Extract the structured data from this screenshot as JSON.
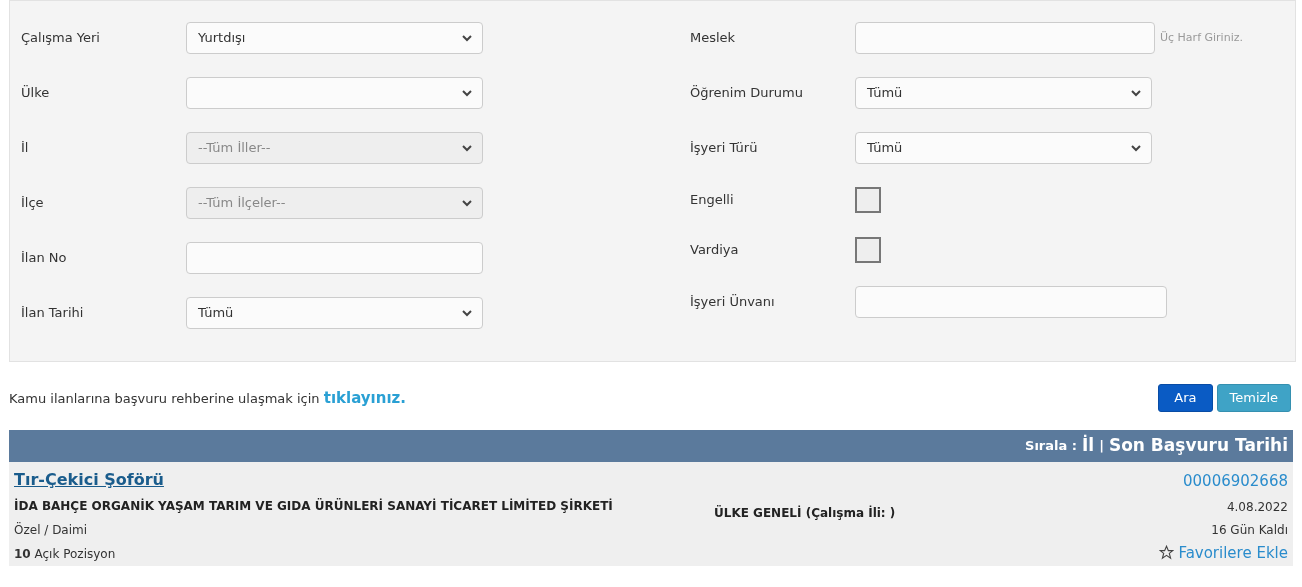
{
  "left_fields": [
    {
      "label": "Çalışma Yeri",
      "kind": "select",
      "value": "Yurtdışı",
      "disabled": false
    },
    {
      "label": "Ülke",
      "kind": "select",
      "disabled": false
    },
    {
      "label": "İl",
      "kind": "select",
      "value": "--Tüm İller--",
      "disabled": true
    },
    {
      "label": "İlçe",
      "kind": "select",
      "value": "--Tüm İlçeler--",
      "disabled": true
    },
    {
      "label": "İlan No",
      "kind": "input",
      "disabled": false
    },
    {
      "label": "İlan Tarihi",
      "kind": "select",
      "value": "Tümü",
      "disabled": false
    }
  ],
  "right_fields": [
    {
      "label": "Meslek",
      "kind": "input",
      "hint": "Üç Harf Giriniz."
    },
    {
      "label": "Öğrenim Durumu",
      "kind": "select",
      "value": "Tümü"
    },
    {
      "label": "İşyeri Türü",
      "kind": "select",
      "value": "Tümü"
    },
    {
      "label": "Engelli",
      "kind": "checkbox",
      "checked": false
    },
    {
      "label": "Vardiya",
      "kind": "checkbox",
      "checked": false
    },
    {
      "label": "İşyeri Ünvanı",
      "kind": "input"
    }
  ],
  "guide": {
    "text": "Kamu ilanlarına başvuru rehberine ulaşmak için",
    "link": "tıklayınız."
  },
  "buttons": [
    {
      "label": "Ara",
      "kind": "primary"
    },
    {
      "label": "Temizle",
      "kind": "secondary"
    }
  ],
  "sort_bar": {
    "label": "Sırala :",
    "options": [
      "İl",
      "Son Başvuru Tarihi"
    ],
    "separator": "|"
  },
  "results": [
    {
      "title": "Tır-Çekici Şoförü",
      "company": "İDA BAHÇE ORGANİK YAŞAM TARIM VE GIDA ÜRÜNLERİ SANAYİ TİCARET LİMİTED ŞİRKETİ",
      "type": "Özel / Daimi",
      "positions_count": "10",
      "positions_label": "Açık Pozisyon",
      "location": "ÜLKE GENELİ (Çalışma İli: )",
      "number": "00006902668",
      "date": "4.08.2022",
      "remaining": "16 Gün Kaldı",
      "favorite": "Favorilere Ekle"
    }
  ]
}
